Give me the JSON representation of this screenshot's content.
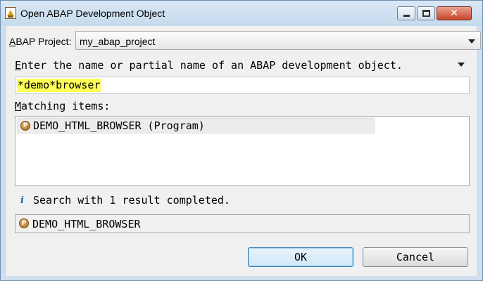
{
  "window": {
    "title": "Open ABAP Development Object",
    "minimize_glyph": "",
    "close_glyph": "✕"
  },
  "project": {
    "label_accel": "A",
    "label_rest": "BAP Project:",
    "value": "my_abap_project"
  },
  "search": {
    "prompt_accel": "E",
    "prompt_rest": "nter the name or partial name of an ABAP development object.",
    "value": "*demo*browser"
  },
  "matching": {
    "label_accel": "M",
    "label_rest": "atching items:",
    "items": [
      {
        "icon": "program-icon",
        "icon_glyph": "P",
        "text": "DEMO_HTML_BROWSER (Program)"
      }
    ]
  },
  "status": {
    "icon_glyph": "i",
    "text": "Search with 1 result completed."
  },
  "selection": {
    "icon_glyph": "P",
    "text": "DEMO_HTML_BROWSER"
  },
  "buttons": {
    "ok": "OK",
    "cancel": "Cancel"
  },
  "colors": {
    "search_highlight": "#ffff55",
    "title_bar": "#cfdff0",
    "close_button": "#c8452c",
    "program_icon": "#a66b1c",
    "info_icon": "#1f5fbf"
  }
}
